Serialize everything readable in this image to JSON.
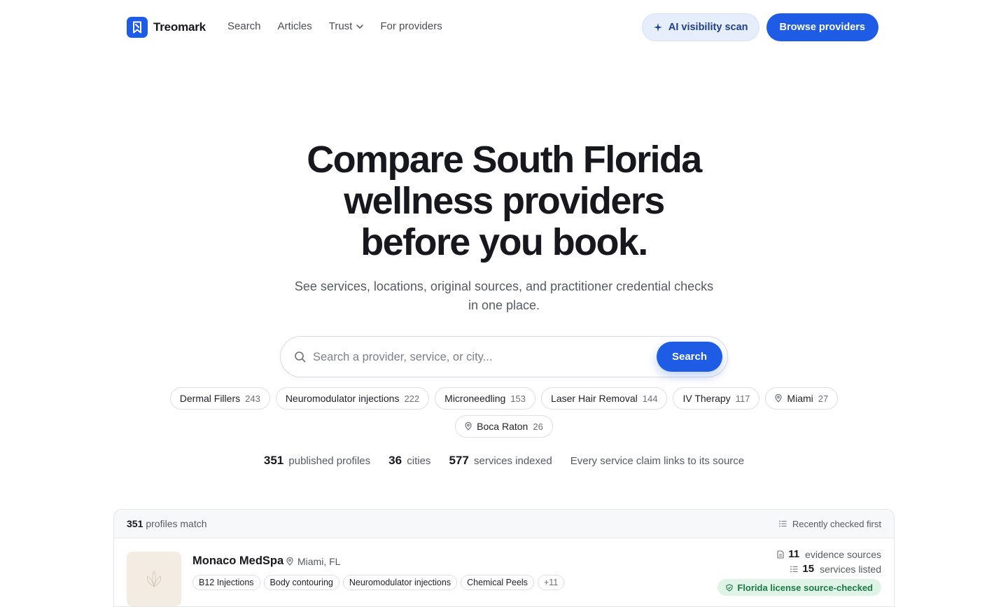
{
  "nav": {
    "brand": "Treomark",
    "links": [
      "Search",
      "Articles",
      "Trust",
      "For providers"
    ],
    "scan_button": "AI visibility scan",
    "browse_button": "Browse providers"
  },
  "hero": {
    "title_lines": [
      "Compare South Florida",
      "wellness providers",
      "before you book."
    ],
    "subtitle": "See services, locations, original sources, and practitioner credential checks in one place."
  },
  "search": {
    "placeholder": "Search a provider, service, or city...",
    "button": "Search"
  },
  "chips": [
    {
      "label": "Dermal Fillers",
      "count": "243",
      "location": false
    },
    {
      "label": "Neuromodulator injections",
      "count": "222",
      "location": false
    },
    {
      "label": "Microneedling",
      "count": "153",
      "location": false
    },
    {
      "label": "Laser Hair Removal",
      "count": "144",
      "location": false
    },
    {
      "label": "IV Therapy",
      "count": "117",
      "location": false
    },
    {
      "label": "Miami",
      "count": "27",
      "location": true
    },
    {
      "label": "Boca Raton",
      "count": "26",
      "location": true
    }
  ],
  "stats": [
    {
      "value": "351",
      "label": "published profiles"
    },
    {
      "value": "36",
      "label": "cities"
    },
    {
      "value": "577",
      "label": "services indexed"
    }
  ],
  "stats_note": "Every service claim links to its source",
  "results": {
    "count": "351",
    "count_label": "profiles match",
    "sort_label": "Recently checked first",
    "items": [
      {
        "name": "Monaco MedSpa",
        "location": "Miami, FL",
        "tags": [
          "B12 Injections",
          "Body contouring",
          "Neuromodulator injections",
          "Chemical Peels"
        ],
        "more": "+11",
        "evidence_count": "11",
        "evidence_label": "evidence sources",
        "services_count": "15",
        "services_label": "services listed",
        "license_badge": "Florida license source-checked"
      }
    ]
  }
}
